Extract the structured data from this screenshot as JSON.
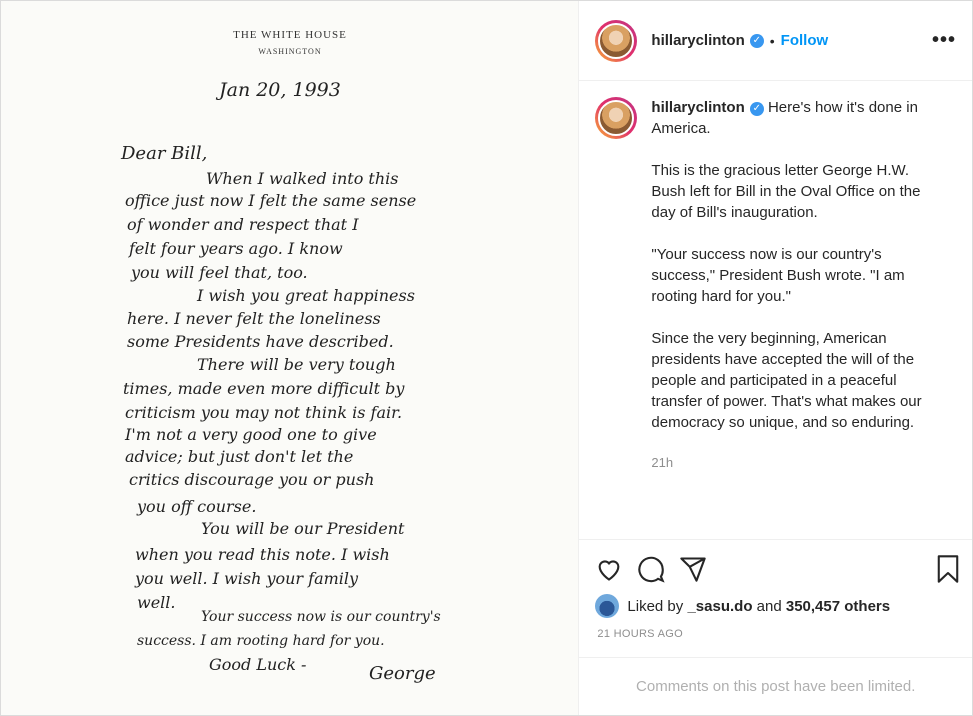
{
  "letter": {
    "letterhead_title": "THE WHITE HOUSE",
    "letterhead_sub": "WASHINGTON",
    "date": "Jan 20, 1993",
    "lines": [
      "Dear Bill,",
      "When I walked into this",
      "office just now I felt the same sense",
      "of wonder and respect that I",
      "felt four years ago. I know",
      "you will feel that, too.",
      "I wish you great happiness",
      "here. I never felt the loneliness",
      "some Presidents have described.",
      "There will be very tough",
      "times, made even more difficult by",
      "criticism you may not think is fair.",
      "I'm not a very good one to give",
      "advice; but just don't let the",
      "critics discourage you or push",
      "you off course.",
      "You will be our President",
      "when you read this note. I wish",
      "you well. I wish your family",
      "well.",
      "Your success now is our country's",
      "success. I am rooting hard for you.",
      "Good Luck -",
      "George"
    ]
  },
  "header": {
    "username": "hillaryclinton",
    "verified_icon": "verified-badge-icon",
    "separator": "•",
    "follow_label": "Follow",
    "more_label": "•••"
  },
  "caption": {
    "username": "hillaryclinton",
    "first_line": "Here's how it's done in America.",
    "paragraphs": [
      "This is the gracious letter George H.W. Bush left for Bill in the Oval Office on the day of Bill's inauguration.",
      "\"Your success now is our country's success,\" President Bush wrote. \"I am rooting hard for you.\"",
      "Since the very beginning, American presidents have accepted the will of the people and participated in a peaceful transfer of power. That's what makes our democracy so unique, and so enduring."
    ],
    "time": "21h"
  },
  "actions": {
    "icons": [
      "heart-icon",
      "comment-icon",
      "share-icon",
      "bookmark-icon"
    ],
    "liked_by_prefix": "Liked by",
    "liked_by_user": "_sasu.do",
    "liked_by_and": "and",
    "likes_count": "350,457 others",
    "posted_ago": "21 HOURS AGO",
    "comments_limited": "Comments on this post have been limited."
  },
  "colors": {
    "accent": "#0095f6",
    "verified": "#3897f0",
    "muted": "#8e8e8e"
  }
}
